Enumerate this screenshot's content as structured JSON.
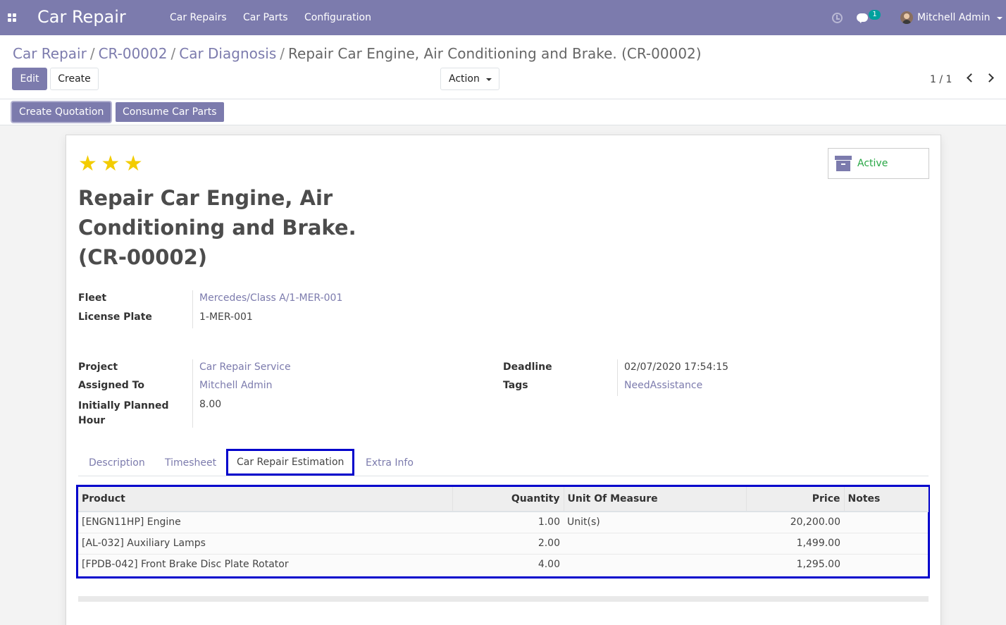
{
  "navbar": {
    "brand": "Car Repair",
    "menu": [
      "Car Repairs",
      "Car Parts",
      "Configuration"
    ],
    "chat_count": "1",
    "user_name": "Mitchell Admin"
  },
  "breadcrumb": {
    "items": [
      "Car Repair",
      "CR-00002",
      "Car Diagnosis"
    ],
    "current": "Repair Car Engine, Air Conditioning and Brake. (CR-00002)"
  },
  "toolbar": {
    "edit_label": "Edit",
    "create_label": "Create",
    "action_label": "Action",
    "pager": "1 / 1"
  },
  "statusbar": {
    "create_quotation_label": "Create Quotation",
    "consume_parts_label": "Consume Car Parts"
  },
  "record": {
    "stars": [
      "★",
      "★",
      "★"
    ],
    "active_label": "Active",
    "title": "Repair Car Engine, Air Conditioning and Brake. (CR-00002)",
    "fleet_label": "Fleet",
    "fleet_value": "Mercedes/Class A/1-MER-001",
    "license_label": "License Plate",
    "license_value": "1-MER-001",
    "project_label": "Project",
    "project_value": "Car Repair Service",
    "assigned_label": "Assigned To",
    "assigned_value": "Mitchell Admin",
    "planned_label": "Initially Planned Hour",
    "planned_value": "8.00",
    "deadline_label": "Deadline",
    "deadline_value": "02/07/2020 17:54:15",
    "tags_label": "Tags",
    "tags_value": "NeedAssistance"
  },
  "tabs": [
    "Description",
    "Timesheet",
    "Car Repair Estimation",
    "Extra Info"
  ],
  "estimation_table": {
    "headers": [
      "Product",
      "Quantity",
      "Unit Of Measure",
      "Price",
      "Notes"
    ],
    "rows": [
      [
        "[ENGN11HP] Engine",
        "1.00",
        "Unit(s)",
        "20,200.00",
        ""
      ],
      [
        "[AL-032] Auxiliary Lamps",
        "2.00",
        "",
        "1,499.00",
        ""
      ],
      [
        "[FPDB-042] Front Brake Disc Plate Rotator",
        "4.00",
        "",
        "1,295.00",
        ""
      ]
    ]
  },
  "colors": {
    "brand": "#7c7bad",
    "active_status": "#28a745",
    "highlight": "#0000cc",
    "star": "#f3cc00"
  }
}
